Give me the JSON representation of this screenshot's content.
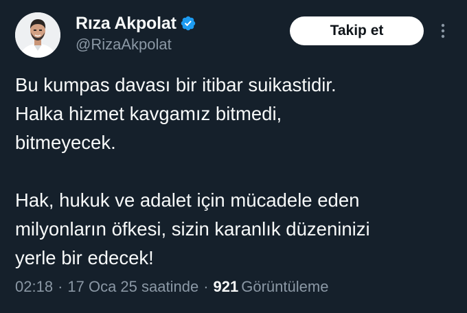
{
  "author": {
    "display_name": "Rıza Akpolat",
    "handle": "@RizaAkpolat",
    "verified_icon": "verified-badge-icon",
    "avatar": "profile-photo"
  },
  "actions": {
    "follow_label": "Takip et",
    "more_icon": "more-vertical-icon"
  },
  "tweet": {
    "paragraph_1": "Bu kumpas davası bir itibar suikastidir.\nHalka hizmet kavgamız bitmedi,\nbitmeyecek.",
    "paragraph_2": "Hak, hukuk ve adalet için mücadele eden\nmilyonların öfkesi, sizin karanlık düzeninizi\nyerle bir edecek!"
  },
  "meta": {
    "time": "02:18",
    "separator": "·",
    "date": "17 Oca 25 saatinde",
    "views_count": "921",
    "views_label": "Görüntüleme"
  },
  "colors": {
    "background": "#15202b",
    "text_primary": "#f7f9f9",
    "text_secondary": "#8b98a5",
    "verified": "#1d9bf0",
    "button_bg": "#ffffff"
  }
}
